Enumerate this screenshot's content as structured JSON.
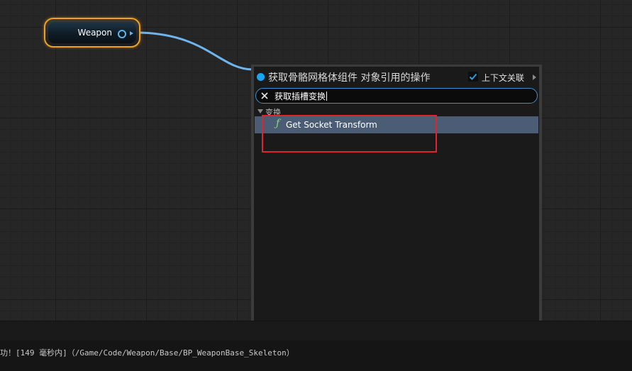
{
  "graph": {
    "node": {
      "label": "Weapon"
    }
  },
  "action_menu": {
    "title": "获取骨骼网格体组件 对象引用的操作",
    "context_sensitive": {
      "label": "上下文关联",
      "checked": true
    },
    "search": {
      "value": "获取插槽变换"
    },
    "categories": [
      {
        "label": "变换",
        "expanded": true,
        "items": [
          {
            "label": "Get Socket Transform",
            "icon": "function-icon",
            "selected": true
          }
        ]
      }
    ]
  },
  "output_log": {
    "line": "功！[149 毫秒内]（/Game/Code/Weapon/Base/BP_WeaponBase_Skeleton）"
  },
  "colors": {
    "node_border": "#f0a020",
    "wire": "#6fb5ec",
    "selection": "#4a5d74",
    "highlight": "#e0242f",
    "accent": "#17a6f2"
  }
}
